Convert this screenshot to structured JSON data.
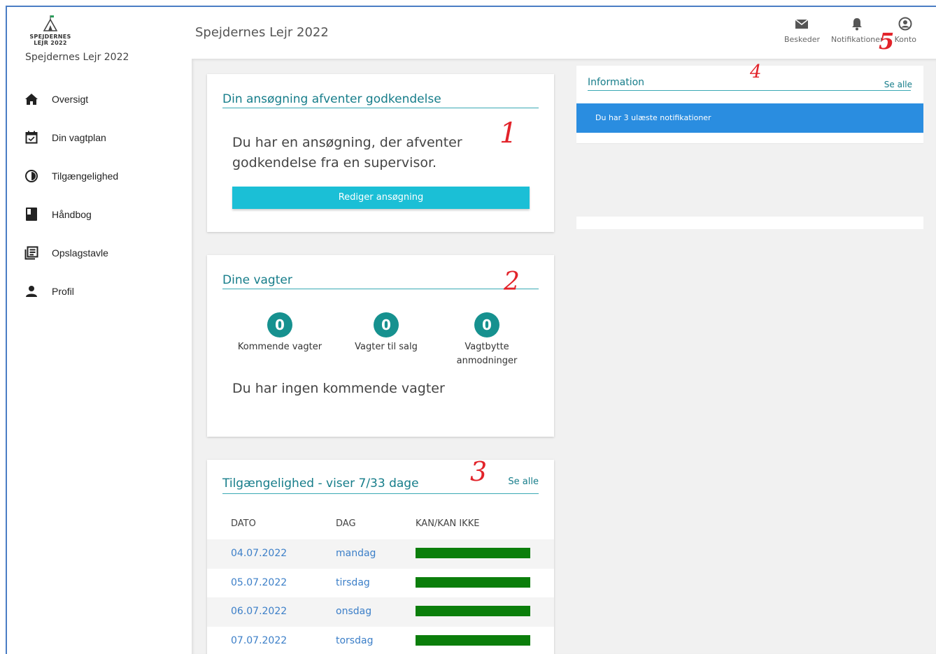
{
  "app": {
    "logo_text": "SPEJDERNES LEJR 2022",
    "name": "Spejdernes Lejr 2022"
  },
  "sidebar": {
    "items": [
      {
        "label": "Oversigt",
        "icon": "home-icon"
      },
      {
        "label": "Din vagtplan",
        "icon": "calendar-check-icon"
      },
      {
        "label": "Tilgængelighed",
        "icon": "availability-clock-icon"
      },
      {
        "label": "Håndbog",
        "icon": "book-icon"
      },
      {
        "label": "Opslagstavle",
        "icon": "bulletin-board-icon"
      },
      {
        "label": "Profil",
        "icon": "person-icon"
      }
    ]
  },
  "header": {
    "title": "Spejdernes Lejr 2022",
    "messages_label": "Beskeder",
    "notifications_label": "Notifikationer",
    "account_label": "Konto"
  },
  "application_card": {
    "title": "Din ansøgning afventer godkendelse",
    "message": "Du har en ansøgning, der afventer godkendelse fra en supervisor.",
    "button_label": "Rediger ansøgning"
  },
  "shifts_card": {
    "title": "Dine vagter",
    "stats": [
      {
        "value": "0",
        "label": "Kommende vagter"
      },
      {
        "value": "0",
        "label": "Vagter til salg"
      },
      {
        "value": "0",
        "label": "Vagtbytte anmodninger"
      }
    ],
    "empty_message": "Du har ingen kommende vagter"
  },
  "availability_card": {
    "title": "Tilgængelighed - viser 7/33 dage",
    "see_all": "Se alle",
    "columns": [
      "DATO",
      "DAG",
      "KAN/KAN IKKE"
    ],
    "rows": [
      {
        "date": "04.07.2022",
        "day": "mandag",
        "available": true
      },
      {
        "date": "05.07.2022",
        "day": "tirsdag",
        "available": true
      },
      {
        "date": "06.07.2022",
        "day": "onsdag",
        "available": true
      },
      {
        "date": "07.07.2022",
        "day": "torsdag",
        "available": true
      }
    ],
    "available_color": "#0b7e0b"
  },
  "info_card": {
    "title": "Information",
    "see_all": "Se alle",
    "notification": "Du har 3 ulæste notifikationer"
  },
  "annotations": [
    "1",
    "2",
    "3",
    "4",
    "5"
  ],
  "colors": {
    "accent": "#167d8a",
    "button": "#1bbfd6",
    "stat_circle": "#16918f",
    "notification": "#2a8de0",
    "annotation": "#e2232a"
  }
}
